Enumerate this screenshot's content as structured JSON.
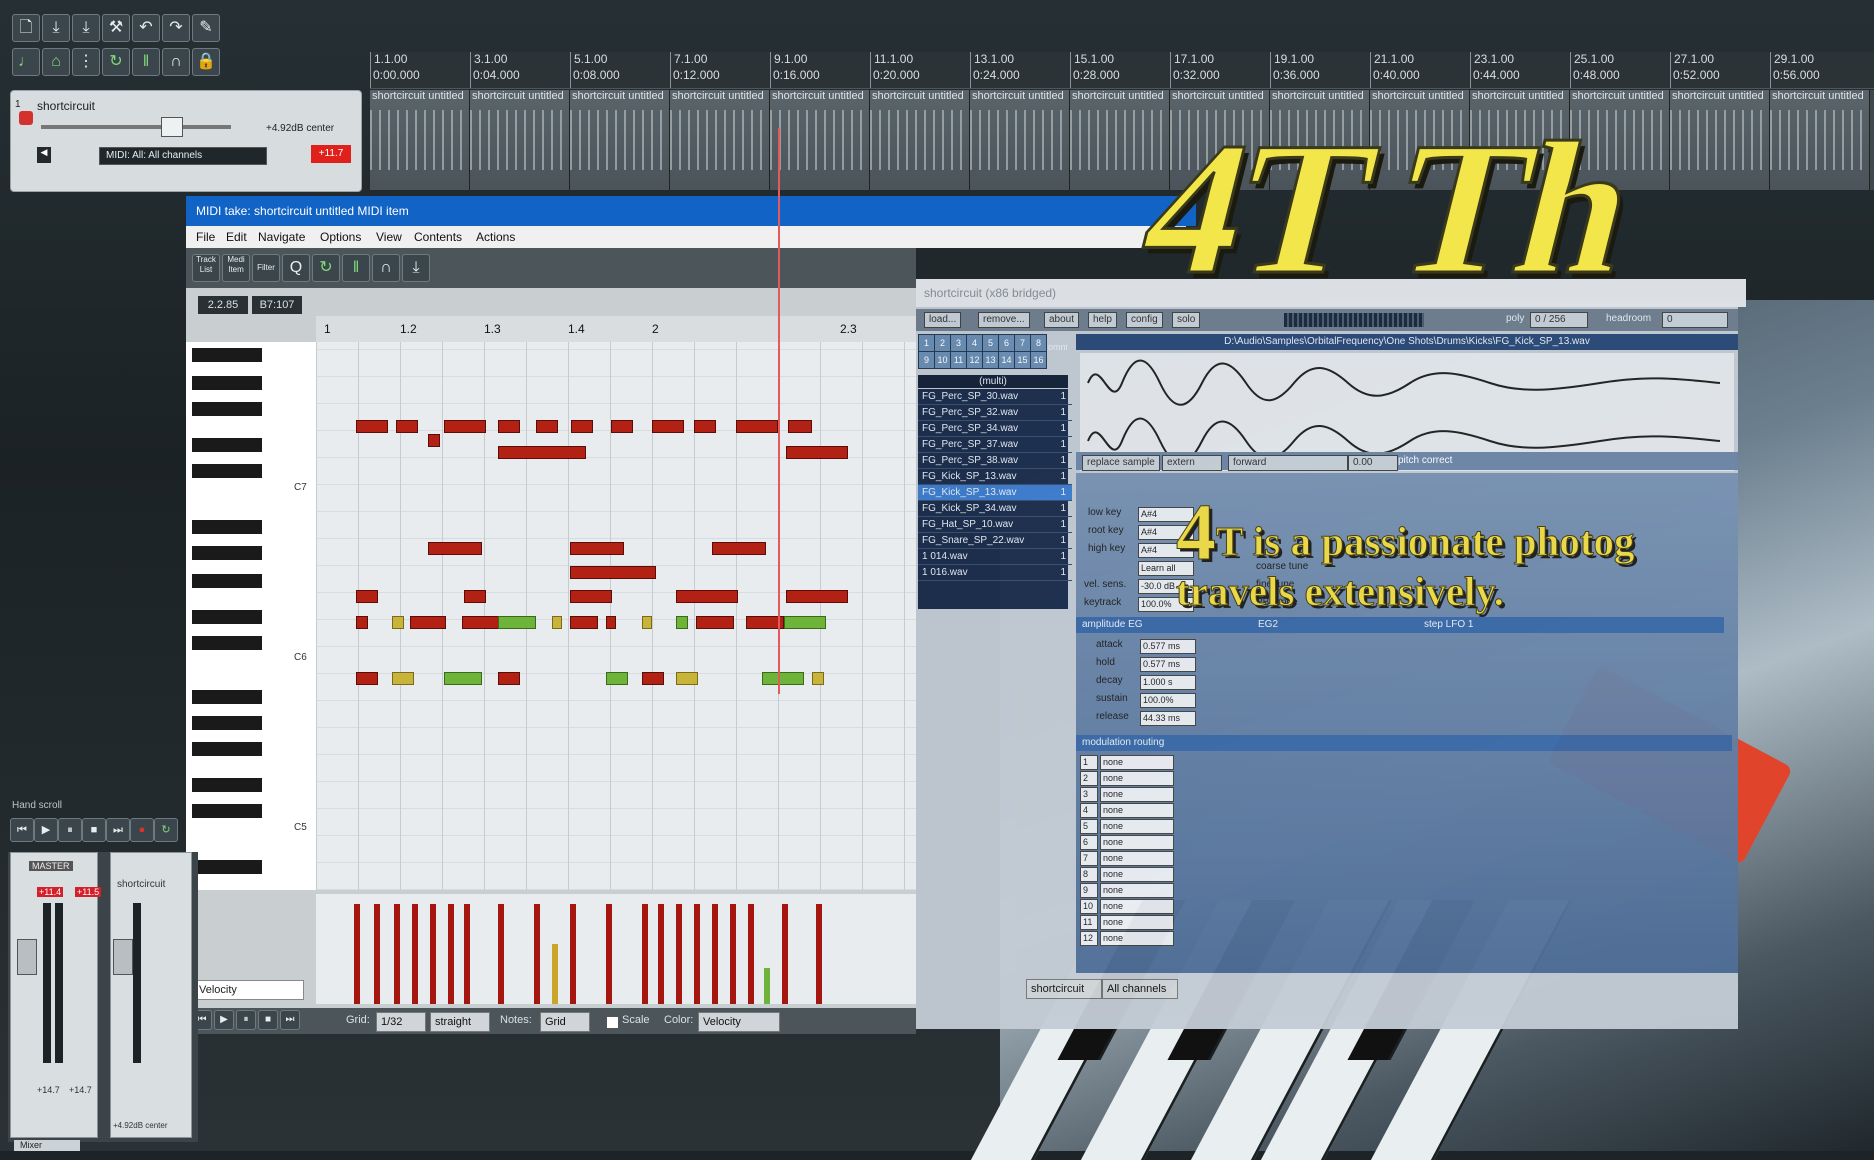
{
  "colors": {
    "brand_yellow": "#f2e64a",
    "titlebar_blue": "#1164c6",
    "note_red": "#b32014",
    "note_green": "#6fb43a"
  },
  "toolbar": {
    "icons": [
      "new-project-icon",
      "save-icon",
      "save-as-icon",
      "settings-wrench-icon",
      "undo-icon",
      "redo-icon",
      "pencil-icon",
      "metronome-icon",
      "snap-icon",
      "grid-icon",
      "loop-icon",
      "ripple-icon",
      "envelope-icon",
      "lock-icon"
    ]
  },
  "timeline": {
    "marks": [
      {
        "bar": "1.1.00",
        "time": "0:00.000"
      },
      {
        "bar": "3.1.00",
        "time": "0:04.000"
      },
      {
        "bar": "5.1.00",
        "time": "0:08.000"
      },
      {
        "bar": "7.1.00",
        "time": "0:12.000"
      },
      {
        "bar": "9.1.00",
        "time": "0:16.000"
      },
      {
        "bar": "11.1.00",
        "time": "0:20.000"
      },
      {
        "bar": "13.1.00",
        "time": "0:24.000"
      },
      {
        "bar": "15.1.00",
        "time": "0:28.000"
      },
      {
        "bar": "17.1.00",
        "time": "0:32.000"
      },
      {
        "bar": "19.1.00",
        "time": "0:36.000"
      },
      {
        "bar": "21.1.00",
        "time": "0:40.000"
      },
      {
        "bar": "23.1.00",
        "time": "0:44.000"
      },
      {
        "bar": "25.1.00",
        "time": "0:48.000"
      },
      {
        "bar": "27.1.00",
        "time": "0:52.000"
      },
      {
        "bar": "29.1.00",
        "time": "0:56.000"
      }
    ],
    "clip_label": "shortcircuit untitled"
  },
  "track": {
    "number": "1",
    "name": "shortcircuit",
    "volume": "+4.92dB center",
    "midi_input": "MIDI: All: All channels",
    "meter_peak": "+11.7"
  },
  "midi_editor": {
    "title": "MIDI take: shortcircuit untitled MIDI item",
    "menu": [
      "File",
      "Edit",
      "Navigate",
      "Options",
      "View",
      "Contents",
      "Actions"
    ],
    "tool_labels": [
      "Track List",
      "Medi Item",
      "Filter"
    ],
    "position": "2.2.85",
    "length": "B7:107",
    "ruler": [
      "1",
      "1.2",
      "1.3",
      "1.4",
      "2",
      "2.3"
    ],
    "key_labels": [
      "C7",
      "C6",
      "C5"
    ],
    "cc_lane": "Velocity",
    "grid_label": "Grid:",
    "grid_value": "1/32",
    "swing": "straight",
    "notes_label": "Notes:",
    "notes_value": "Grid",
    "scale_label": "Scale",
    "color_label": "Color:",
    "color_value": "Velocity"
  },
  "sampler": {
    "title": "shortcircuit (x86 bridged)",
    "buttons": [
      "load...",
      "remove...",
      "about",
      "help",
      "config",
      "solo"
    ],
    "polyphony_label": "poly",
    "polyphony": "0 / 256",
    "headroom_label": "headroom",
    "headroom": "0",
    "slots_row1": [
      "1",
      "2",
      "3",
      "4",
      "5",
      "6",
      "7",
      "8"
    ],
    "slots_row2": [
      "9",
      "10",
      "11",
      "12",
      "13",
      "14",
      "15",
      "16"
    ],
    "slot_mode": "(multi)",
    "omni": "omni",
    "samples": [
      {
        "name": "FG_Perc_SP_30.wav",
        "n": "1"
      },
      {
        "name": "FG_Perc_SP_32.wav",
        "n": "1"
      },
      {
        "name": "FG_Perc_SP_34.wav",
        "n": "1"
      },
      {
        "name": "FG_Perc_SP_37.wav",
        "n": "1"
      },
      {
        "name": "FG_Perc_SP_38.wav",
        "n": "1"
      },
      {
        "name": "FG_Kick_SP_13.wav",
        "n": "1"
      },
      {
        "name": "FG_Kick_SP_13.wav",
        "n": "1"
      },
      {
        "name": "FG_Kick_SP_34.wav",
        "n": "1"
      },
      {
        "name": "FG_Hat_SP_10.wav",
        "n": "1"
      },
      {
        "name": "FG_Snare_SP_22.wav",
        "n": "1"
      },
      {
        "name": "1 014.wav",
        "n": "1"
      },
      {
        "name": "1 016.wav",
        "n": "1"
      }
    ],
    "selected_sample": 6,
    "path": "D:\\Audio\\Samples\\OrbitalFrequency\\One Shots\\Drums\\Kicks\\FG_Kick_SP_13.wav",
    "sample_buttons": [
      "replace sample",
      "extern",
      "forward",
      "0.00",
      "pitch correct"
    ],
    "keys": [
      {
        "label": "low key",
        "value": "A#4"
      },
      {
        "label": "root key",
        "value": "A#4"
      },
      {
        "label": "high key",
        "value": "A#4"
      }
    ],
    "learn": "Learn all",
    "coarse_tune": "coarse tune",
    "fine_tune": "fine tune",
    "pb_range": "PB range",
    "vel_sens": {
      "label": "vel. sens.",
      "value": "-30.0 dB"
    },
    "keytrack": {
      "label": "keytrack",
      "value": "100.0%"
    },
    "eg_title": "amplitude EG",
    "eg2_title": "EG2",
    "lfo_title": "step LFO 1",
    "eg": [
      {
        "label": "attack",
        "value": "0.577 ms"
      },
      {
        "label": "hold",
        "value": "0.577 ms"
      },
      {
        "label": "decay",
        "value": "1.000 s"
      },
      {
        "label": "sustain",
        "value": "100.0%"
      },
      {
        "label": "release",
        "value": "44.33 ms"
      }
    ],
    "mod_title": "modulation routing",
    "mod_rows": [
      "none",
      "none",
      "none",
      "none",
      "none",
      "none",
      "none",
      "none",
      "none",
      "none",
      "none",
      "none"
    ],
    "bottom_dd": "shortcircuit",
    "bottom_dd2": "All channels"
  },
  "overlay": {
    "brand": "4T Th",
    "tagline_lead": "4",
    "tagline1": "T is a passionate photog",
    "tagline2": "travels extensively."
  },
  "mixer": {
    "hand_scroll": "Hand scroll",
    "master": "MASTER",
    "master_db1": "+11.4",
    "master_db2": "+11.5",
    "strip_name": "shortcircuit",
    "strip_db": "+4.92dB center",
    "master_peak1": "+14.7",
    "master_peak2": "+14.7",
    "tab": "Mixer"
  }
}
